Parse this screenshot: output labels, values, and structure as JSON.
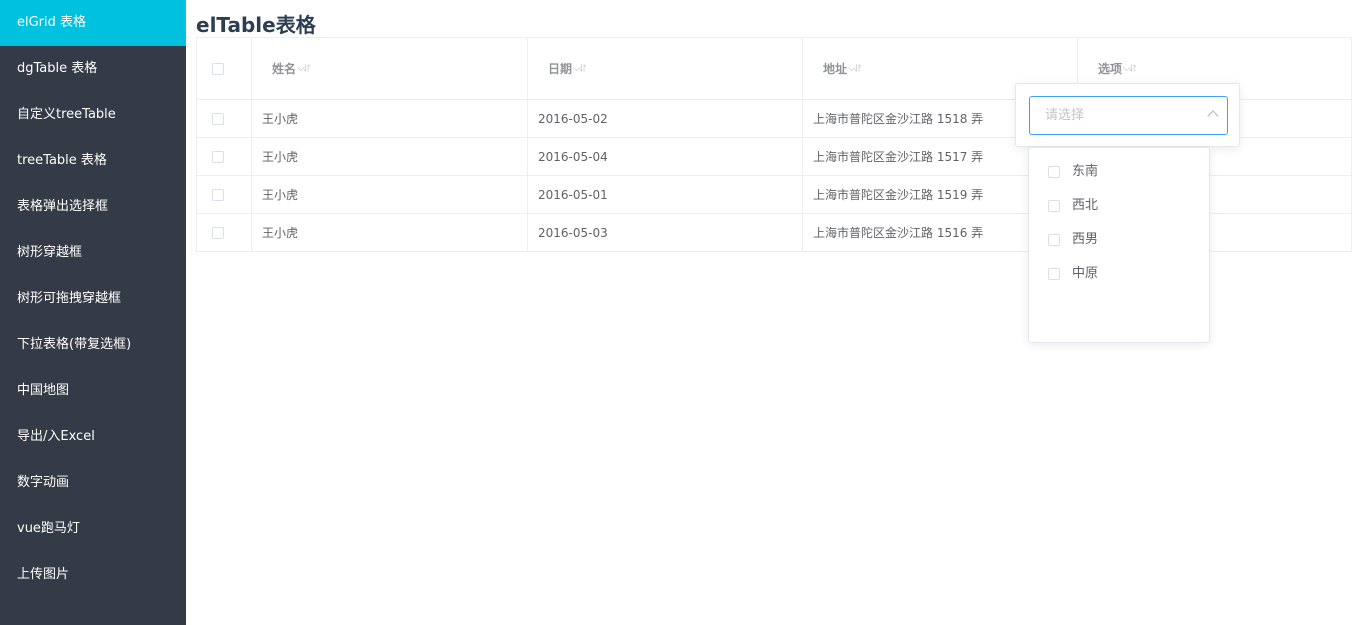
{
  "sidebar": {
    "items": [
      {
        "label": "elGrid 表格"
      },
      {
        "label": "dgTable 表格"
      },
      {
        "label": "自定义treeTable"
      },
      {
        "label": "treeTable 表格"
      },
      {
        "label": "表格弹出选择框"
      },
      {
        "label": "树形穿越框"
      },
      {
        "label": "树形可拖拽穿越框"
      },
      {
        "label": "下拉表格(带复选框)"
      },
      {
        "label": "中国地图"
      },
      {
        "label": "导出/入Excel"
      },
      {
        "label": "数字动画"
      },
      {
        "label": "vue跑马灯"
      },
      {
        "label": "上传图片"
      }
    ],
    "active_index": 0
  },
  "main": {
    "title": "elTable表格",
    "table": {
      "headers": [
        "姓名",
        "日期",
        "地址",
        "选项"
      ],
      "sort_icon": "⌵⥯",
      "rows": [
        {
          "name": "王小虎",
          "date": "2016-05-02",
          "address": "上海市普陀区金沙江路 1518 弄"
        },
        {
          "name": "王小虎",
          "date": "2016-05-04",
          "address": "上海市普陀区金沙江路 1517 弄"
        },
        {
          "name": "王小虎",
          "date": "2016-05-01",
          "address": "上海市普陀区金沙江路 1519 弄"
        },
        {
          "name": "王小虎",
          "date": "2016-05-03",
          "address": "上海市普陀区金沙江路 1516 弄"
        }
      ]
    },
    "filter_dropdown": {
      "placeholder": "请选择",
      "options": [
        "东南",
        "西北",
        "西男",
        "中原"
      ]
    }
  },
  "colors": {
    "sidebar_bg": "#343a46",
    "active_bg": "#00c1de",
    "select_border": "#409eff"
  },
  "icons": [
    "chevron-down-icon",
    "sort-icon",
    "checkbox-icon"
  ]
}
